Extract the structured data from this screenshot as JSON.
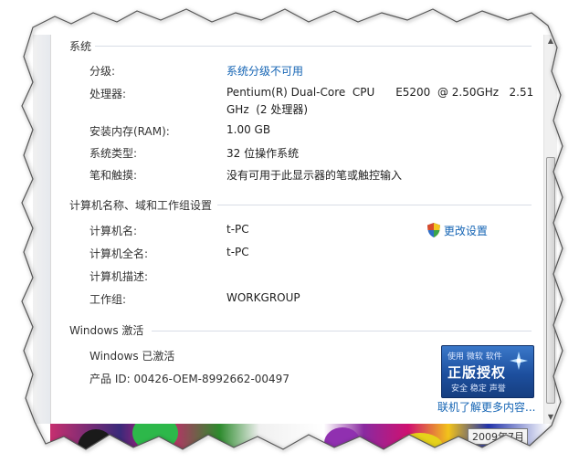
{
  "sections": {
    "system": {
      "title": "系统",
      "rows": [
        {
          "label": "分级:",
          "value": "系统分级不可用"
        },
        {
          "label": "处理器:",
          "value": "Pentium(R) Dual-Core  CPU      E5200  @ 2.50GHz   2.51",
          "value2": "GHz  (2 处理器)"
        },
        {
          "label": "安装内存(RAM):",
          "value": "1.00 GB"
        },
        {
          "label": "系统类型:",
          "value": "32 位操作系统"
        },
        {
          "label": "笔和触摸:",
          "value": "没有可用于此显示器的笔或触控输入"
        }
      ]
    },
    "computer": {
      "title": "计算机名称、域和工作组设置",
      "change_settings": "更改设置",
      "rows": [
        {
          "label": "计算机名:",
          "value": "t-PC"
        },
        {
          "label": "计算机全名:",
          "value": "t-PC"
        },
        {
          "label": "计算机描述:",
          "value": ""
        },
        {
          "label": "工作组:",
          "value": "WORKGROUP"
        }
      ]
    },
    "activation": {
      "title": "Windows 激活",
      "status": "Windows 已激活",
      "product_id": "产品 ID: 00426-OEM-8992662-00497",
      "badge": {
        "line1": "使用 微软 软件",
        "line2": "正版授权",
        "line3": "安全  稳定  声誉"
      },
      "more_link": "联机了解更多内容..."
    }
  },
  "taskbar_tooltip": "2009年7月",
  "colors": {
    "link": "#1464b4",
    "badge_blue": "#1d4f9e"
  }
}
